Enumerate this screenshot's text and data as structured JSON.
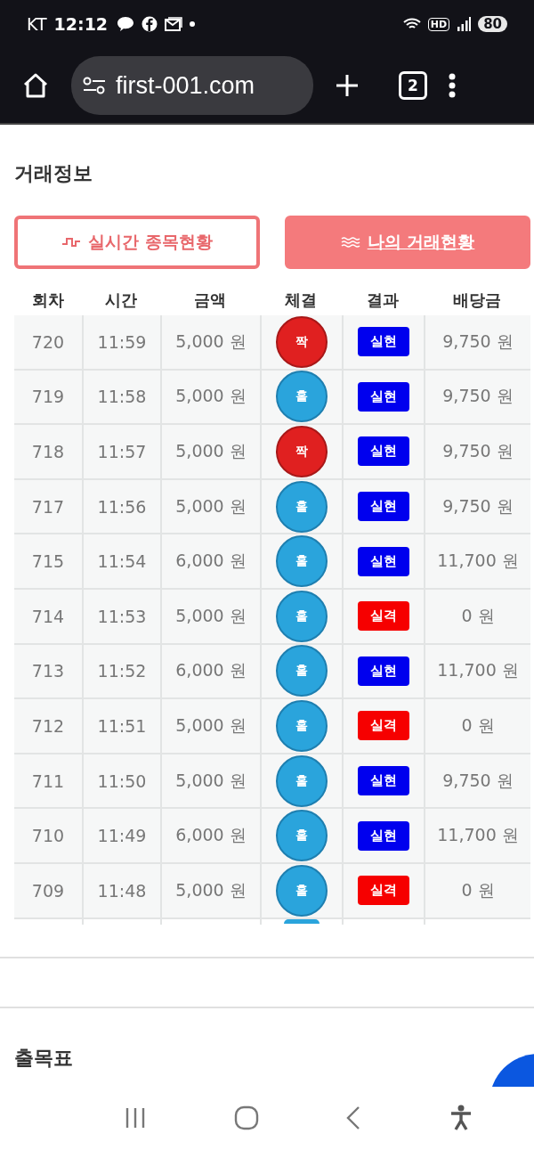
{
  "status_bar": {
    "carrier": "KT",
    "time": "12:12",
    "hd": "HD",
    "battery": "80"
  },
  "browser": {
    "url": "first-001.com",
    "tab_count": "2"
  },
  "section_title": "거래정보",
  "tabs": [
    {
      "label": "실시간 종목현황",
      "selected": false
    },
    {
      "label": "나의 거래현황",
      "selected": true
    }
  ],
  "table": {
    "columns": [
      "회차",
      "시간",
      "금액",
      "체결",
      "결과",
      "배당금"
    ],
    "rows": [
      {
        "round": "720",
        "time": "11:59",
        "amount": "5,000 원",
        "pick": {
          "label": "짝",
          "kind": "even"
        },
        "result": {
          "label": "실현",
          "kind": "win"
        },
        "payout": "9,750 원"
      },
      {
        "round": "719",
        "time": "11:58",
        "amount": "5,000 원",
        "pick": {
          "label": "홀",
          "kind": "odd"
        },
        "result": {
          "label": "실현",
          "kind": "win"
        },
        "payout": "9,750 원"
      },
      {
        "round": "718",
        "time": "11:57",
        "amount": "5,000 원",
        "pick": {
          "label": "짝",
          "kind": "even"
        },
        "result": {
          "label": "실현",
          "kind": "win"
        },
        "payout": "9,750 원"
      },
      {
        "round": "717",
        "time": "11:56",
        "amount": "5,000 원",
        "pick": {
          "label": "홀",
          "kind": "odd"
        },
        "result": {
          "label": "실현",
          "kind": "win"
        },
        "payout": "9,750 원"
      },
      {
        "round": "715",
        "time": "11:54",
        "amount": "6,000 원",
        "pick": {
          "label": "홀",
          "kind": "odd"
        },
        "result": {
          "label": "실현",
          "kind": "win"
        },
        "payout": "11,700 원"
      },
      {
        "round": "714",
        "time": "11:53",
        "amount": "5,000 원",
        "pick": {
          "label": "홀",
          "kind": "odd"
        },
        "result": {
          "label": "실격",
          "kind": "lose"
        },
        "payout": "0 원"
      },
      {
        "round": "713",
        "time": "11:52",
        "amount": "6,000 원",
        "pick": {
          "label": "홀",
          "kind": "odd"
        },
        "result": {
          "label": "실현",
          "kind": "win"
        },
        "payout": "11,700 원"
      },
      {
        "round": "712",
        "time": "11:51",
        "amount": "5,000 원",
        "pick": {
          "label": "홀",
          "kind": "odd"
        },
        "result": {
          "label": "실격",
          "kind": "lose"
        },
        "payout": "0 원"
      },
      {
        "round": "711",
        "time": "11:50",
        "amount": "5,000 원",
        "pick": {
          "label": "홀",
          "kind": "odd"
        },
        "result": {
          "label": "실현",
          "kind": "win"
        },
        "payout": "9,750 원"
      },
      {
        "round": "710",
        "time": "11:49",
        "amount": "6,000 원",
        "pick": {
          "label": "홀",
          "kind": "odd"
        },
        "result": {
          "label": "실현",
          "kind": "win"
        },
        "payout": "11,700 원"
      },
      {
        "round": "709",
        "time": "11:48",
        "amount": "5,000 원",
        "pick": {
          "label": "홀",
          "kind": "odd"
        },
        "result": {
          "label": "실격",
          "kind": "lose"
        },
        "payout": "0 원"
      }
    ]
  },
  "next_section_title": "출목표"
}
